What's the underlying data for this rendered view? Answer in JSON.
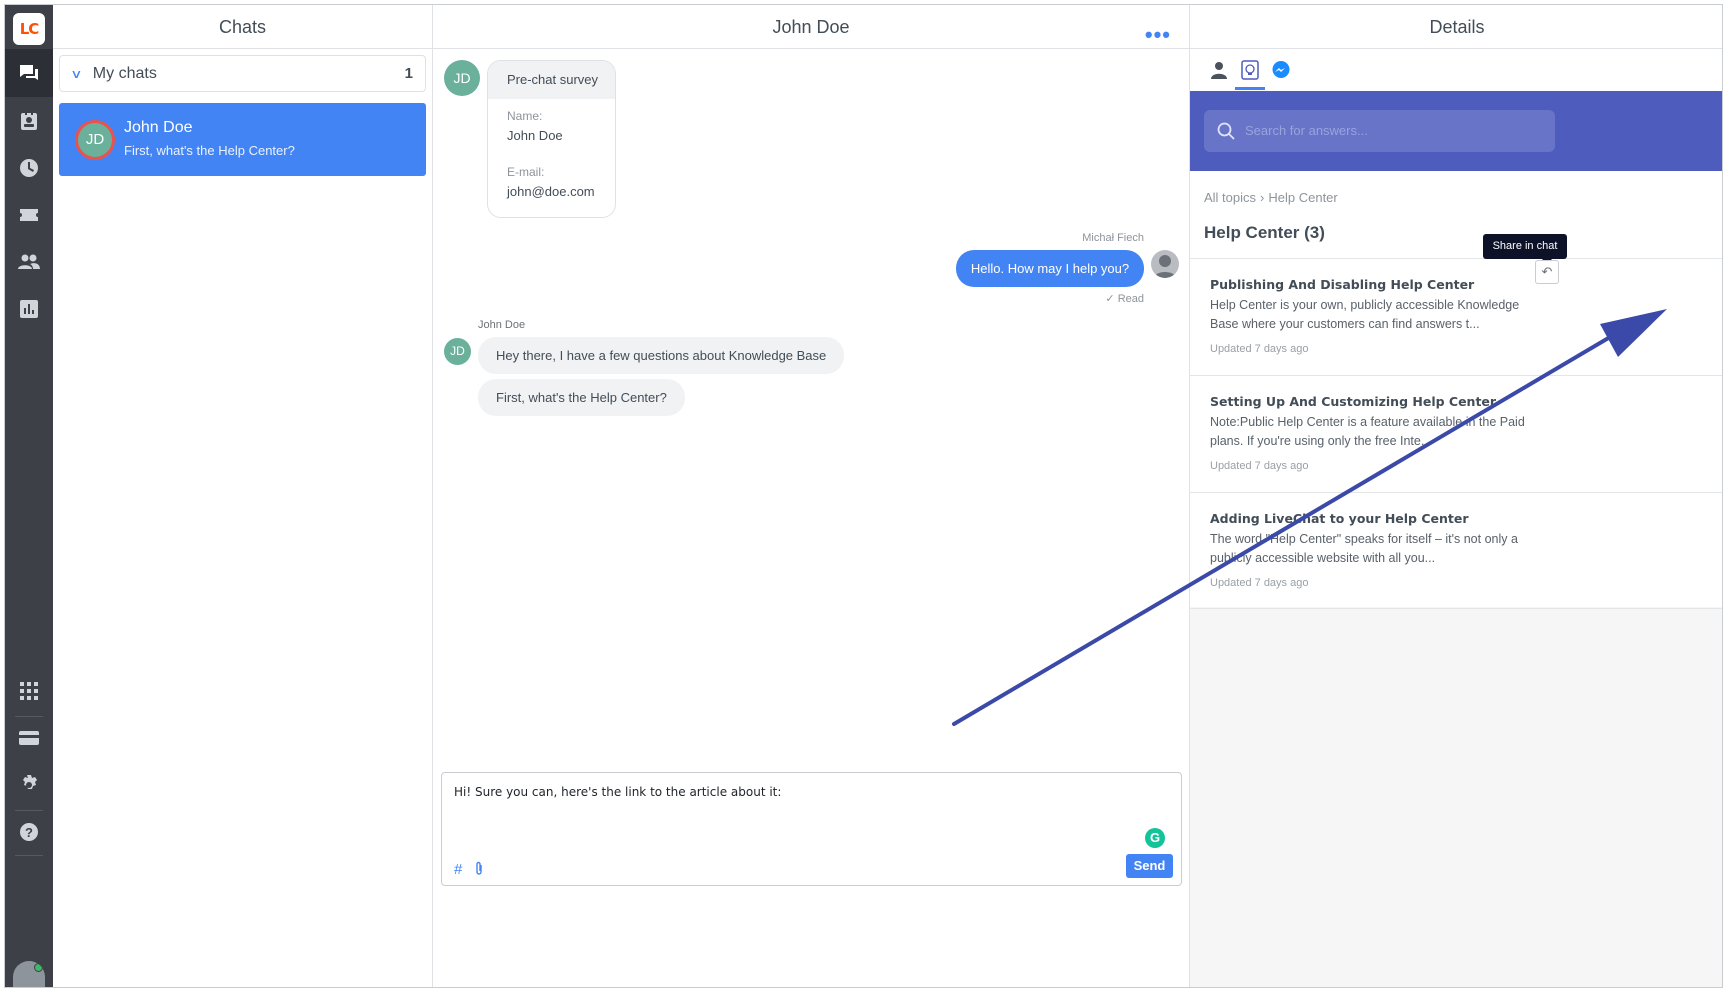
{
  "rail": {
    "logo": "LC"
  },
  "chats_panel": {
    "title": "Chats",
    "group": {
      "label": "My chats",
      "count": "1"
    },
    "items": [
      {
        "initials": "JD",
        "name": "John Doe",
        "last_message": "First, what's the Help Center?"
      }
    ]
  },
  "conversation": {
    "title": "John Doe",
    "more_icon": "ellipsis-icon",
    "customer_initials": "JD",
    "survey": {
      "title": "Pre-chat survey",
      "name_label": "Name:",
      "name_value": "John Doe",
      "email_label": "E-mail:",
      "email_value": "john@doe.com"
    },
    "agent_name": "Michał Fiech",
    "agent_message": "Hello. How may I help you?",
    "read_status": "Read",
    "customer_name": "John Doe",
    "customer_messages": [
      "Hey there, I have a few questions about Knowledge Base",
      "First, what's the Help Center?"
    ],
    "composer": {
      "text": "Hi! Sure you can, here's the link to the article about it:",
      "send_label": "Send",
      "hash": "#",
      "grammarly": "G"
    }
  },
  "details": {
    "title": "Details",
    "tabs": [
      "customer-icon",
      "knowledge-base-icon",
      "messenger-icon"
    ],
    "search_placeholder": "Search for answers...",
    "breadcrumb": {
      "root": "All topics",
      "current": "Help Center"
    },
    "section_title": "Help Center (3)",
    "tooltip": "Share in chat",
    "articles": [
      {
        "title": "Publishing And Disabling Help Center",
        "excerpt": "Help Center is your own, publicly accessible Knowledge Base where your customers can find answers t...",
        "updated": "Updated 7 days ago"
      },
      {
        "title": "Setting Up And Customizing Help Center",
        "excerpt": "Note:Public Help Center is a feature available in the Paid plans. If you're using only the free Inte...",
        "updated": "Updated 7 days ago"
      },
      {
        "title": "Adding LiveChat to your Help Center",
        "excerpt": "The word \"Help Center\" speaks for itself – it's not only a publicly accessible website with all you...",
        "updated": "Updated 7 days ago"
      }
    ]
  },
  "colors": {
    "accent": "#4384f5",
    "kb_header": "#4d5cbd",
    "annotation_arrow": "#3b4aa8",
    "rail": "#3d4047"
  }
}
